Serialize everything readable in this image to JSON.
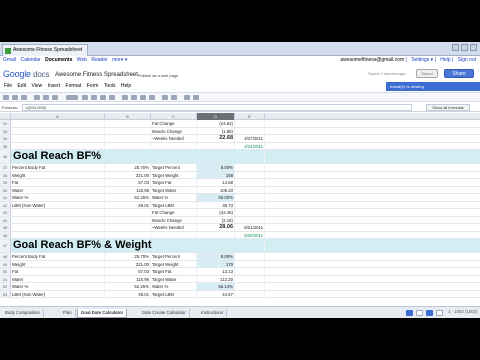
{
  "browser": {
    "tab_title": "Awesome Fitness Spreadsheet"
  },
  "gbar": {
    "links": [
      "Gmail",
      "Calendar",
      "Documents",
      "Web",
      "Reader",
      "more ▾"
    ],
    "active": "Documents",
    "user": "awesomefitness@gmail.com",
    "settings": "Settings ▾",
    "help": "Help",
    "signout": "Sign out"
  },
  "header": {
    "logo_google": "Google",
    "logo_docs": "docs",
    "title": "Awesome Fitness Spreadsheet",
    "publish": "Publish as a web page",
    "saved_text": "Saved 2 minutes ago",
    "saved_button": "Saved",
    "share_button": "Share"
  },
  "menu": {
    "items": [
      "File",
      "Edit",
      "View",
      "Insert",
      "Format",
      "Form",
      "Tools",
      "Help"
    ],
    "viewing": "Install(1) is viewing"
  },
  "formula": {
    "label": "Formula:",
    "value": "=(D93-D96)",
    "show_all": "Show all formulas"
  },
  "columns": [
    "A",
    "B",
    "C",
    "D",
    "E"
  ],
  "rows": [
    {
      "n": "32",
      "a": "",
      "b": "",
      "c": "Fat Change",
      "d": "(24.62)",
      "e": ""
    },
    {
      "n": "33",
      "a": "",
      "b": "",
      "c": "Muscle Change",
      "d": "(1.88)",
      "e": ""
    },
    {
      "n": "34",
      "a": "",
      "b": "",
      "c": "~Weeks Needed",
      "d": "22.68",
      "e": "4/27/2011",
      "bold_d": true
    },
    {
      "n": "35",
      "a": "",
      "b": "",
      "c": "",
      "d": "",
      "e": "4/24/2011",
      "green_e": true
    },
    {
      "n": "36",
      "big": "Goal Reach BF%"
    },
    {
      "n": "37",
      "a": "Percent Body Fat",
      "b": "25.70%",
      "c": "Target Percent",
      "d": "8.00%",
      "e": "",
      "hl_d": true
    },
    {
      "n": "38",
      "a": "Weight",
      "b": "221.00",
      "c": "Target Weight",
      "d": "168",
      "e": "",
      "hl_d": true
    },
    {
      "n": "39",
      "a": "Fat",
      "b": "57.03",
      "c": "Target Fat",
      "d": "14.58",
      "e": ""
    },
    {
      "n": "40",
      "a": "Water",
      "b": "115.96",
      "c": "Target Water",
      "d": "109.20",
      "e": ""
    },
    {
      "n": "41",
      "a": "Water %",
      "b": "52.25%",
      "c": "Water %",
      "d": "65.00%",
      "e": "",
      "hl_d": true
    },
    {
      "n": "42",
      "a": "LBM (Non Water)",
      "b": "48.01",
      "c": "Target LBM",
      "d": "36.73",
      "e": ""
    },
    {
      "n": "43",
      "a": "",
      "b": "",
      "c": "Fat Change",
      "d": "(42.45)",
      "e": ""
    },
    {
      "n": "44",
      "a": "",
      "b": "",
      "c": "Muscle Change",
      "d": "(2.18)",
      "e": ""
    },
    {
      "n": "45",
      "a": "",
      "b": "",
      "c": "~Weeks Needed",
      "d": "28.06",
      "e": "6/21/2011",
      "bold_d": true
    },
    {
      "n": "46",
      "a": "",
      "b": "",
      "c": "",
      "d": "",
      "e": "5/29/2011",
      "green_e": true
    },
    {
      "n": "47",
      "big": "Goal Reach BF% & Weight"
    },
    {
      "n": "48",
      "a": "Percent Body Fat",
      "b": "25.70%",
      "c": "Target Percent",
      "d": "8.00%",
      "e": "",
      "hl_d": true
    },
    {
      "n": "49",
      "a": "Weight",
      "b": "221.00",
      "c": "Target Weight",
      "d": "170",
      "e": "",
      "hl_d": true
    },
    {
      "n": "50",
      "a": "Fat",
      "b": "57.03",
      "c": "Target Fat",
      "d": "13.13",
      "e": ""
    },
    {
      "n": "51",
      "a": "Water",
      "b": "115.96",
      "c": "Target Water",
      "d": "112.20",
      "e": ""
    },
    {
      "n": "52",
      "a": "Water %",
      "b": "52.25%",
      "c": "Water %",
      "d": "66.14%",
      "e": "",
      "hl_d": true
    },
    {
      "n": "53",
      "a": "LBM (Non Water)",
      "b": "48.01",
      "c": "Target LBM",
      "d": "44.67",
      "e": ""
    }
  ],
  "sheets": [
    "Body Composition",
    "Plan",
    "Goal Date Calculator",
    "Date Create Calculator",
    "Instructions"
  ],
  "active_sheet": "Goal Date Calculator",
  "sheet_info": "1 - 1002 (1002)"
}
